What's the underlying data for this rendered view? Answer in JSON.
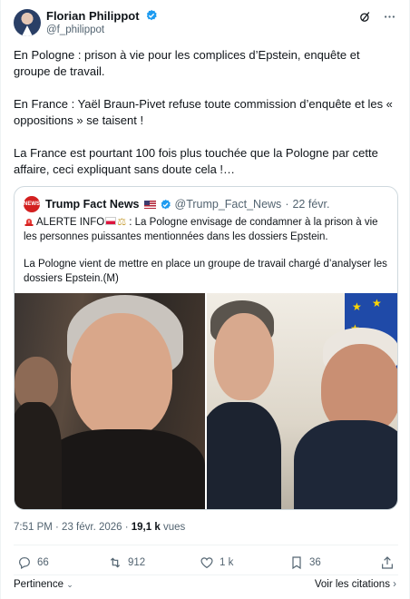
{
  "author": {
    "name": "Florian Philippot",
    "handle": "@f_philippot"
  },
  "tweet": {
    "paragraphs": [
      "En Pologne : prison à vie pour les complices d’Epstein, enquête et groupe de travail.",
      "En France : Yaël Braun-Pivet refuse toute commission d’enquête et les « oppositions » se taisent !",
      "La France est pourtant 100 fois plus touchée que la Pologne par cette affaire, ceci expliquant sans doute cela !…"
    ]
  },
  "quote": {
    "avatar_text": "NEWS",
    "name": "Trump Fact News",
    "handle": "@Trump_Fact_News",
    "separator": "·",
    "date": "22 févr.",
    "alert_label": "ALERTE INFO",
    "line1": " : La Pologne envisage de condamner à la prison à vie les personnes puissantes mentionnées dans les dossiers Epstein.",
    "line2": "La Pologne vient de mettre en place un groupe de travail chargé d’analyser les dossiers Epstein.(M)"
  },
  "meta": {
    "time_date": "7:51 PM · 23 févr. 2026 · ",
    "views_count": "19,1 k",
    "views_label": " vues"
  },
  "actions": {
    "replies": "66",
    "reposts": "912",
    "likes": "1 k",
    "bookmarks": "36"
  },
  "footer": {
    "relevance": "Pertinence",
    "quotes_link": "Voir les citations"
  },
  "colors": {
    "verified_blue": "#1d9bf0",
    "secondary_text": "#536471",
    "alert_red": "#d32020"
  },
  "icons": [
    "verified-badge-icon",
    "grok-icon",
    "more-icon",
    "siren-icon",
    "reply-icon",
    "repost-icon",
    "like-icon",
    "bookmark-icon",
    "share-icon",
    "chevron-down-icon",
    "chevron-right-icon"
  ]
}
